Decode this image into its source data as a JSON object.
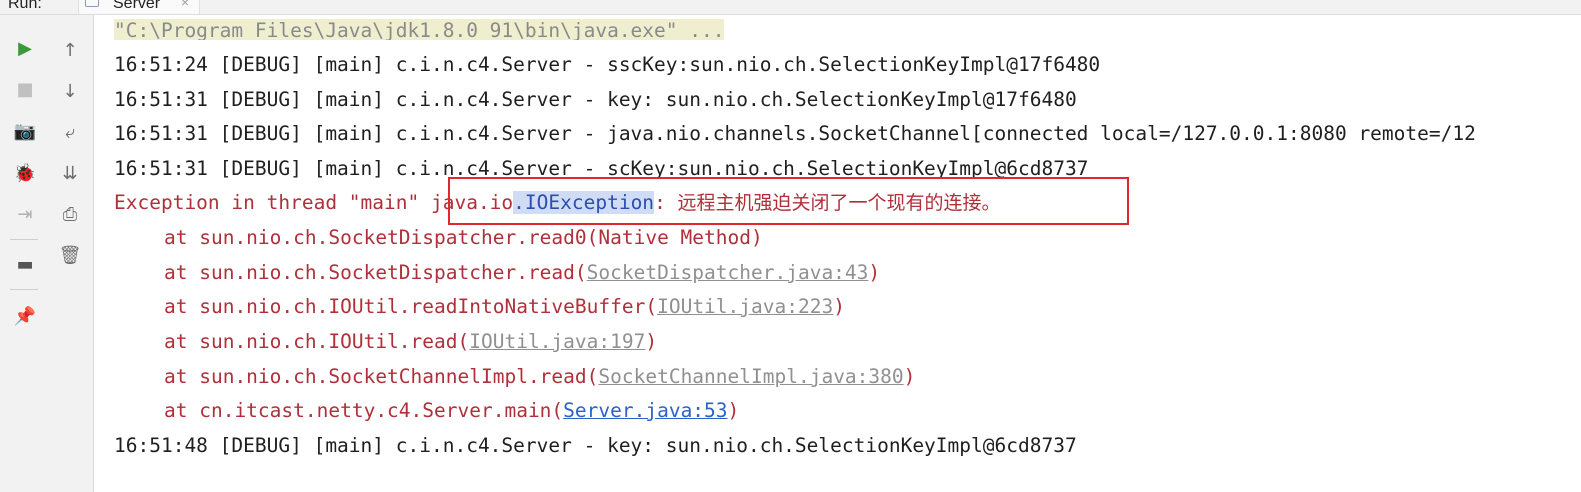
{
  "header": {
    "run_label": "Run:",
    "tab_title": "Server",
    "tab_close": "×"
  },
  "toolbar": {
    "left": [
      {
        "icon": "run-icon",
        "glyph": "▶",
        "color": "#3a9a3a"
      },
      {
        "icon": "stop-icon",
        "glyph": "■",
        "color": "#c0c0c0"
      },
      {
        "icon": "camera-icon",
        "glyph": "📷",
        "color": "#b0b0b0"
      },
      {
        "icon": "debug-bug-icon",
        "glyph": "🐞",
        "color": "#c0c0c0"
      },
      {
        "icon": "login-icon",
        "glyph": "⇥",
        "color": "#b0b0b0"
      },
      {
        "icon": "layout-icon",
        "glyph": "▬",
        "color": "#555555"
      },
      {
        "icon": "pin-icon",
        "glyph": "📌",
        "color": "#666666"
      }
    ],
    "right": [
      {
        "icon": "up-arrow-icon",
        "glyph": "↑"
      },
      {
        "icon": "down-arrow-icon",
        "glyph": "↓"
      },
      {
        "icon": "soft-wrap-icon",
        "glyph": "⤶"
      },
      {
        "icon": "scroll-to-end-icon",
        "glyph": "⇊"
      },
      {
        "icon": "print-icon",
        "glyph": "⎙"
      },
      {
        "icon": "trash-icon",
        "glyph": "🗑"
      }
    ]
  },
  "console": {
    "cmd_line": "\"C:\\Program Files\\Java\\jdk1.8.0_91\\bin\\java.exe\" ...",
    "lines": [
      "16:51:24 [DEBUG] [main] c.i.n.c4.Server - sscKey:sun.nio.ch.SelectionKeyImpl@17f6480",
      "16:51:31 [DEBUG] [main] c.i.n.c4.Server - key: sun.nio.ch.SelectionKeyImpl@17f6480",
      "16:51:31 [DEBUG] [main] c.i.n.c4.Server - java.nio.channels.SocketChannel[connected local=/127.0.0.1:8080 remote=/12",
      "16:51:31 [DEBUG] [main] c.i.n.c4.Server - scKey:sun.nio.ch.SelectionKeyImpl@6cd8737"
    ],
    "exception": {
      "prefix": "Exception in thread \"main\" ",
      "class_prefix": "java.io",
      "class_selected": ".IOException",
      "colon": ": ",
      "message": "远程主机强迫关闭了一个现有的连接。"
    },
    "stack": [
      {
        "text": "at sun.nio.ch.SocketDispatcher.read0(Native Method)",
        "link": "",
        "close": ""
      },
      {
        "text": "at sun.nio.ch.SocketDispatcher.read(",
        "link": "SocketDispatcher.java:43",
        "close": ")"
      },
      {
        "text": "at sun.nio.ch.IOUtil.readIntoNativeBuffer(",
        "link": "IOUtil.java:223",
        "close": ")"
      },
      {
        "text": "at sun.nio.ch.IOUtil.read(",
        "link": "IOUtil.java:197",
        "close": ")"
      },
      {
        "text": "at sun.nio.ch.SocketChannelImpl.read(",
        "link": "SocketChannelImpl.java:380",
        "close": ")"
      },
      {
        "text": "at cn.itcast.netty.c4.Server.main(",
        "link": "Server.java:53",
        "close": ")"
      }
    ],
    "last_line": "16:51:48 [DEBUG] [main] c.i.n.c4.Server - key: sun.nio.ch.SelectionKeyImpl@6cd8737"
  },
  "colors": {
    "error_text": "#b0303a",
    "highlight_box": "#e0262e",
    "user_link": "#2a62c9",
    "selection": "#cfdcf4"
  }
}
